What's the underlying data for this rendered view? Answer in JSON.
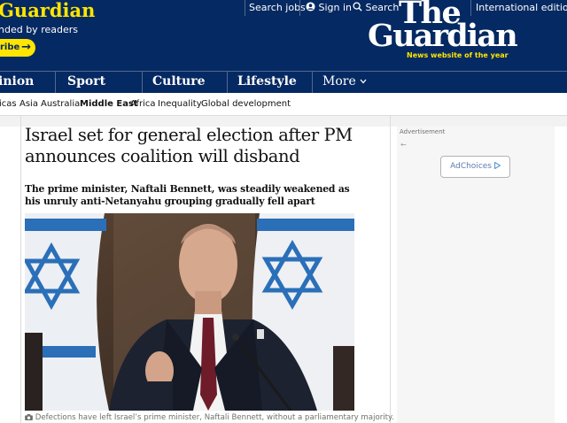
{
  "header": {
    "support_title": "Guardian",
    "support_subtitle": "nded by readers",
    "subscribe_label": "ribe",
    "subscribe_arrow": "→",
    "links": {
      "search_jobs": "Search jobs",
      "sign_in": "Sign in",
      "search": "Search",
      "edition": "International edition"
    },
    "logo": {
      "line1": "The",
      "line2": "Guardian",
      "tagline": "News website of the year"
    }
  },
  "nav": {
    "pillars": [
      "inion",
      "Sport",
      "Culture",
      "Lifestyle"
    ],
    "more": "More"
  },
  "subnav": {
    "items": [
      "icas",
      "Asia",
      "Australia",
      "Middle East",
      "Africa",
      "Inequality",
      "Global development"
    ],
    "active": "Middle East"
  },
  "article": {
    "headline": "Israel set for general election after PM announces coalition will disband",
    "standfirst": "The prime minister, Naftali Bennett, was steadily weakened as his unruly anti-Netanyahu grouping gradually fell apart",
    "caption": "Defections have left Israel’s prime minister, Naftali Bennett, without a parliamentary majority."
  },
  "ad": {
    "label": "Advertisement",
    "back": "←",
    "choices": "AdChoices"
  },
  "colors": {
    "brand": "#052962",
    "accent": "#ffe500"
  }
}
